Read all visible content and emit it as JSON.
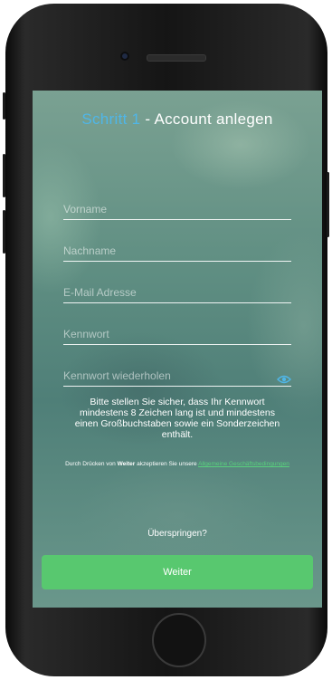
{
  "header": {
    "step_label": "Schritt 1",
    "title_rest": " - Account anlegen"
  },
  "form": {
    "first_name_placeholder": "Vorname",
    "last_name_placeholder": "Nachname",
    "email_placeholder": "E-Mail Adresse",
    "password_placeholder": "Kennwort",
    "password_repeat_placeholder": "Kennwort wiederholen"
  },
  "hint": "Bitte stellen Sie sicher, dass Ihr Kennwort mindestens 8 Zeichen lang ist und mindestens einen Großbuchstaben sowie ein Sonderzeichen enthält.",
  "terms": {
    "prefix": "Durch Drücken von ",
    "bold": "Weiter",
    "middle": " akzeptieren Sie unsere ",
    "link": "Allgemeine Geschäftsbedingungen"
  },
  "skip_label": "Überspringen?",
  "next_button": "Weiter",
  "colors": {
    "accent_blue": "#4fb6e8",
    "button_green": "#58c86f",
    "link_green": "#58d27d"
  },
  "icons": {
    "show_password": "eye-icon"
  }
}
